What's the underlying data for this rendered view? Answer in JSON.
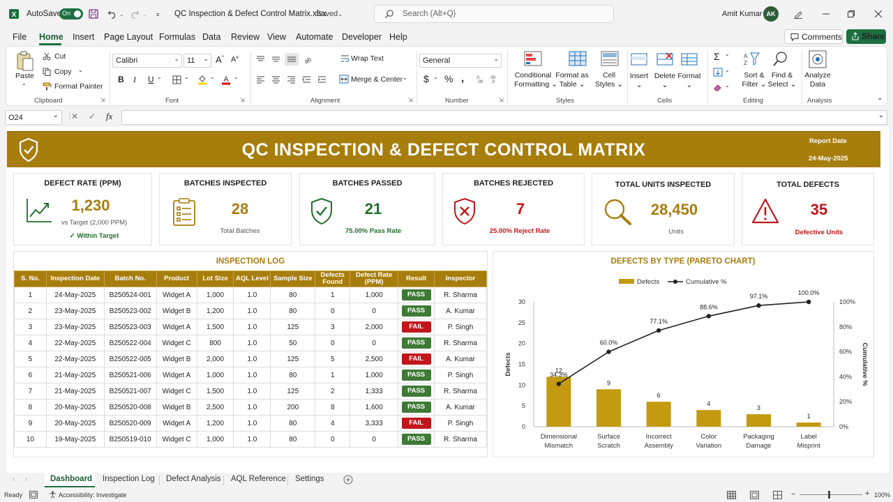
{
  "titlebar": {
    "autosave_label": "AutoSave",
    "toggle_label": "On",
    "file_title": "QC Inspection & Defect Control Matrix.xlsx",
    "saved_label": "Saved",
    "search_placeholder": "Search (Alt+Q)",
    "user_name": "Amit Kumar",
    "user_initials": "AK"
  },
  "menu": {
    "items": [
      "File",
      "Home",
      "Insert",
      "Page Layout",
      "Formulas",
      "Data",
      "Review",
      "View",
      "Automate",
      "Developer",
      "Help"
    ],
    "comments": "Comments",
    "share": "Share"
  },
  "ribbon": {
    "clipboard": {
      "paste": "Paste",
      "cut": "Cut",
      "copy": "Copy",
      "format_painter": "Format Painter",
      "label": "Clipboard"
    },
    "font": {
      "name": "Calibri",
      "size": "11",
      "bold": "B",
      "italic": "I",
      "underline": "U",
      "label": "Font"
    },
    "alignment": {
      "wrap": "Wrap Text",
      "merge": "Merge & Center",
      "label": "Alignment"
    },
    "number": {
      "format": "General",
      "label": "Number"
    },
    "styles": {
      "conditional": "Conditional",
      "formatting": "Formatting",
      "format_as": "Format as",
      "table": "Table",
      "cell": "Cell",
      "styles": "Styles",
      "label": "Styles"
    },
    "cells": {
      "insert": "Insert",
      "delete": "Delete",
      "format": "Format",
      "label": "Cells"
    },
    "editing": {
      "sort": "Sort &",
      "filter": "Filter",
      "find": "Find &",
      "select": "Select",
      "label": "Editing"
    },
    "analysis": {
      "analyze": "Analyze",
      "data": "Data",
      "label": "Analysis"
    }
  },
  "formula_bar": {
    "cell_ref": "O24",
    "fx": "fx",
    "content": ""
  },
  "dashboard": {
    "title": "QC INSPECTION & DEFECT CONTROL MATRIX",
    "report_date_label": "Report Date",
    "report_date": "24-May-2025",
    "kpis": [
      {
        "title": "DEFECT RATE (PPM)",
        "value": "1,230",
        "sub1": "vs Target (2,000 PPM)",
        "sub2": "✓ Within Target",
        "color": "#a77d0c"
      },
      {
        "title": "BATCHES INSPECTED",
        "value": "28",
        "sub1": "Total Batches",
        "color": "#a77d0c"
      },
      {
        "title": "BATCHES PASSED",
        "value": "21",
        "sub1": "75.00% Pass Rate",
        "color": "#1f6e2e"
      },
      {
        "title": "BATCHES REJECTED",
        "value": "7",
        "sub1": "25.00% Reject Rate",
        "color": "#c0161a"
      },
      {
        "title": "TOTAL UNITS INSPECTED",
        "value": "28,450",
        "sub1": "Units",
        "color": "#a77d0c"
      },
      {
        "title": "TOTAL DEFECTS",
        "value": "35",
        "sub1": "Defective Units",
        "color": "#c0161a"
      }
    ]
  },
  "log": {
    "title": "INSPECTION LOG",
    "headers": [
      "S. No.",
      "Inspection Date",
      "Batch No.",
      "Product",
      "Lot Size",
      "AQL Level",
      "Sample Size",
      "Defects Found",
      "Defect Rate (PPM)",
      "Result",
      "Inspector"
    ],
    "rows": [
      [
        "1",
        "24-May-2025",
        "B250524-001",
        "Widget A",
        "1,000",
        "1.0",
        "80",
        "1",
        "1,000",
        "PASS",
        "R. Sharma"
      ],
      [
        "2",
        "23-May-2025",
        "B250523-002",
        "Widget B",
        "1,200",
        "1.0",
        "80",
        "0",
        "0",
        "PASS",
        "A. Kumar"
      ],
      [
        "3",
        "23-May-2025",
        "B250523-003",
        "Widget A",
        "1,500",
        "1.0",
        "125",
        "3",
        "2,000",
        "FAIL",
        "P. Singh"
      ],
      [
        "4",
        "22-May-2025",
        "B250522-004",
        "Widget C",
        "800",
        "1.0",
        "50",
        "0",
        "0",
        "PASS",
        "R. Sharma"
      ],
      [
        "5",
        "22-May-2025",
        "B250522-005",
        "Widget B",
        "2,000",
        "1.0",
        "125",
        "5",
        "2,500",
        "FAIL",
        "A. Kumar"
      ],
      [
        "6",
        "21-May-2025",
        "B250521-006",
        "Widget A",
        "1,000",
        "1.0",
        "80",
        "1",
        "1,000",
        "PASS",
        "P. Singh"
      ],
      [
        "7",
        "21-May-2025",
        "B250521-007",
        "Widget C",
        "1,500",
        "1.0",
        "125",
        "2",
        "1,333",
        "PASS",
        "R. Sharma"
      ],
      [
        "8",
        "20-May-2025",
        "B250520-008",
        "Widget B",
        "2,500",
        "1.0",
        "200",
        "8",
        "1,600",
        "PASS",
        "A. Kumar"
      ],
      [
        "9",
        "20-May-2025",
        "B250520-009",
        "Widget A",
        "1,200",
        "1.0",
        "80",
        "4",
        "3,333",
        "FAIL",
        "P. Singh"
      ],
      [
        "10",
        "19-May-2025",
        "B250519-010",
        "Widget C",
        "1,000",
        "1.0",
        "80",
        "0",
        "0",
        "PASS",
        "R. Sharma"
      ]
    ]
  },
  "chart_data": {
    "type": "bar",
    "title": "DEFECTS BY TYPE (PARETO CHART)",
    "categories": [
      "Dimensional Mismatch",
      "Surface Scratch",
      "Incorrect Assembly",
      "Color Variation",
      "Packaging Damage",
      "Label Misprint"
    ],
    "series": [
      {
        "name": "Defects",
        "type": "bar",
        "values": [
          12,
          9,
          6,
          4,
          3,
          1
        ],
        "color": "#c39a10"
      },
      {
        "name": "Cumulative %",
        "type": "line",
        "values": [
          34.3,
          60.0,
          77.1,
          88.6,
          97.1,
          100.0
        ],
        "color": "#222222"
      }
    ],
    "ylabel": "Defects",
    "y2label": "Cumulative %",
    "ylim": [
      0,
      30
    ],
    "y2lim": [
      0,
      100
    ],
    "yticks": [
      "0",
      "5",
      "10",
      "15",
      "20",
      "25",
      "30"
    ],
    "y2ticks": [
      "0%",
      "20%",
      "40%",
      "60%",
      "80%",
      "100%"
    ],
    "bar_labels": [
      "12",
      "9",
      "6",
      "4",
      "3",
      "1"
    ],
    "line_labels": [
      "34.3%",
      "60.0%",
      "77.1%",
      "88.6%",
      "97.1%",
      "100.0%"
    ],
    "legend": "top"
  },
  "sheet_tabs": {
    "tabs": [
      "Dashboard",
      "Inspection Log",
      "Defect Analysis",
      "AQL Reference",
      "Settings"
    ],
    "active": "Dashboard"
  },
  "status": {
    "ready": "Ready",
    "accessibility": "Accessibility: Investigate",
    "zoom": "100%"
  }
}
